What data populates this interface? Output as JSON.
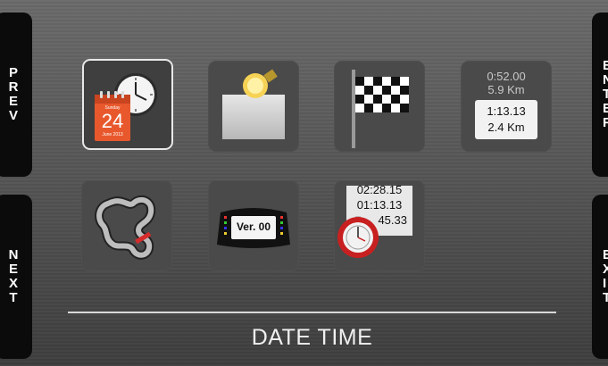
{
  "nav": {
    "prev_label": [
      "P",
      "R",
      "E",
      "V"
    ],
    "next_label": [
      "N",
      "E",
      "X",
      "T"
    ],
    "enter_label": [
      "E",
      "N",
      "T",
      "E",
      "R"
    ],
    "exit_label": [
      "E",
      "X",
      "I",
      "T"
    ]
  },
  "screen_title": "DATE TIME",
  "tiles": {
    "date_time": {
      "calendar_day": "Sunday",
      "calendar_date": "24",
      "calendar_month": "June 2013"
    },
    "lap_times": {
      "prev_time": "0:52.00",
      "prev_dist": "5.9 Km",
      "time": "1:13.13",
      "dist": "2.4 Km"
    },
    "version": {
      "label": "Ver. 00"
    },
    "stopwatch": {
      "line1": "02:28.15",
      "line2": "01:13.13",
      "line3": "45.33"
    }
  },
  "colors": {
    "selected_outline": "#e8e8e8",
    "calendar_orange": "#e8582c",
    "marker_red": "#d52b2b"
  }
}
